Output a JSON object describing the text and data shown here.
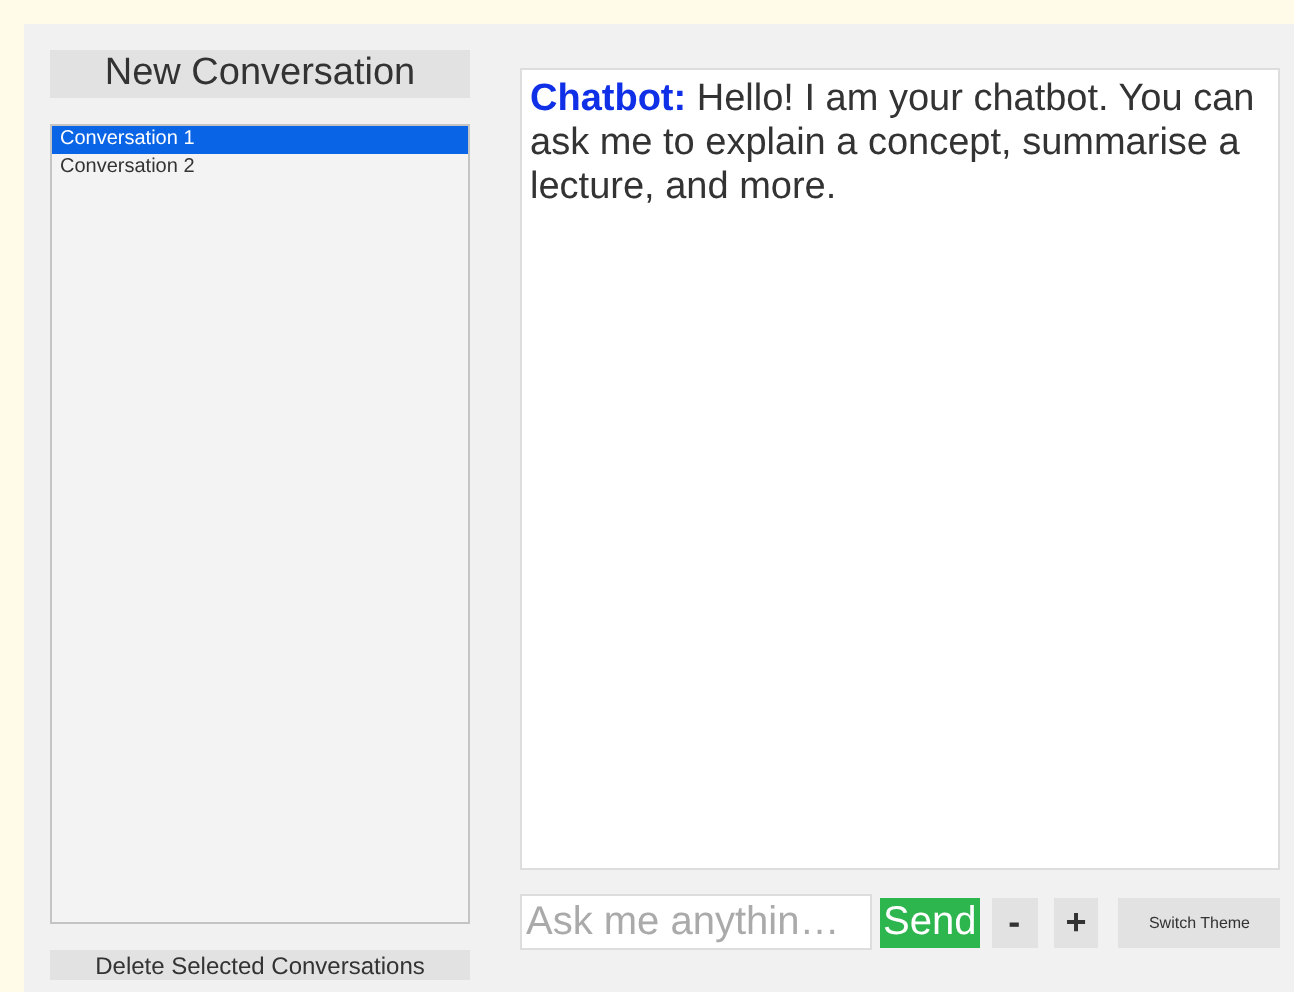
{
  "new_button": "New Conversation",
  "conversations": [
    {
      "label": "Conversation 1",
      "selected": true
    },
    {
      "label": "Conversation 2",
      "selected": false
    }
  ],
  "delete_button": "Delete Selected Conversations",
  "messages": [
    {
      "speaker": "Chatbot:",
      "text": "Hello! I am your chatbot. You can ask me to explain a concept, summarise a lecture, and more."
    }
  ],
  "input": {
    "placeholder": "Ask me anythin…"
  },
  "send_button": "Send",
  "minus_button": "-",
  "plus_button": "+",
  "theme_button": "Switch Theme"
}
